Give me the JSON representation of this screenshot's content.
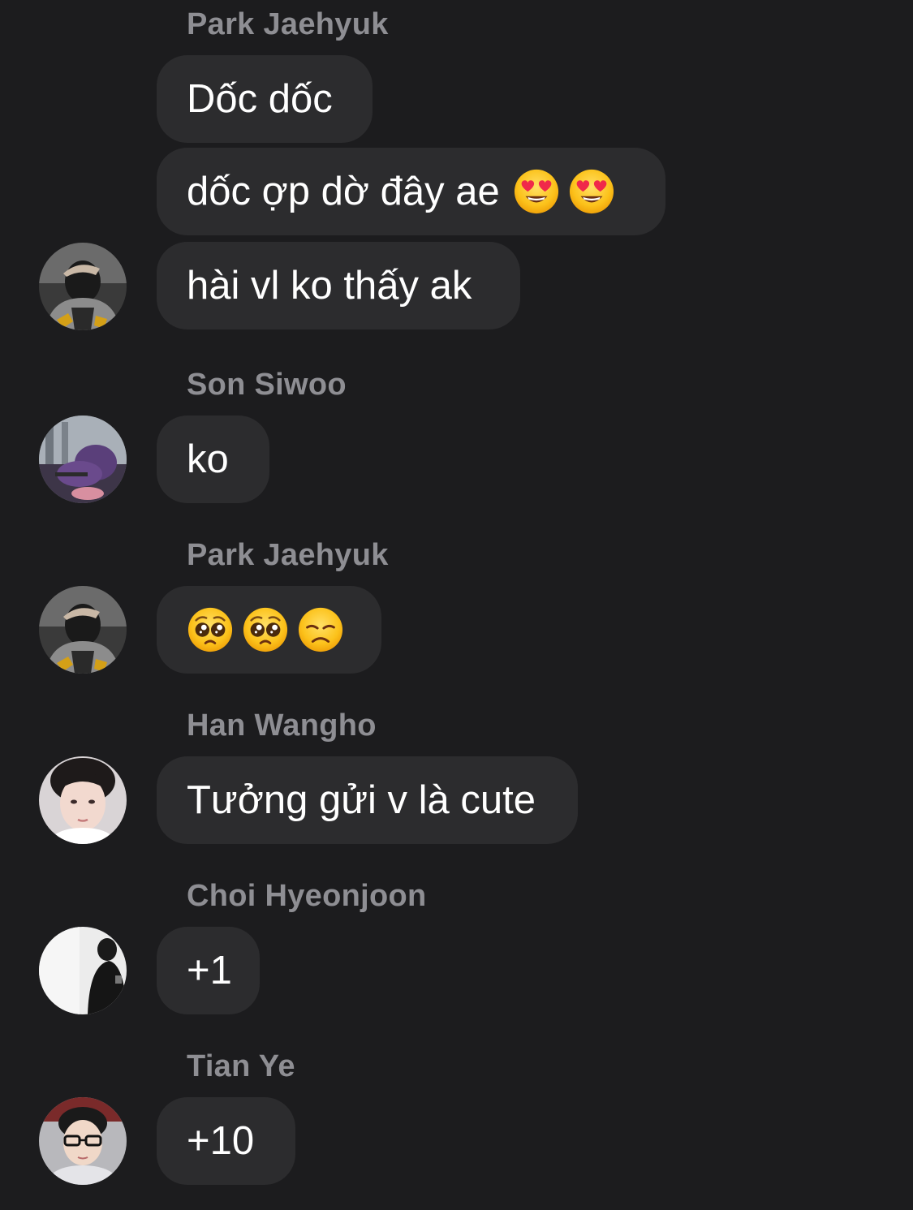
{
  "colors": {
    "background": "#1c1c1e",
    "bubble": "#2c2c2e",
    "sender_name": "#8e8e93",
    "message_text": "#ffffff"
  },
  "messages": [
    {
      "sender": "Park Jaehyuk",
      "text": "Dốc dốc"
    },
    {
      "text": "dốc ợp dờ đây ae",
      "emojis": [
        "smiling-face-with-heart-eyes",
        "smiling-face-with-heart-eyes"
      ]
    },
    {
      "text": "hài vl ko thấy ak",
      "avatar": "avatar-park-jaehyuk"
    },
    {
      "sender": "Son Siwoo",
      "text": "ko",
      "avatar": "avatar-son-siwoo"
    },
    {
      "sender": "Park Jaehyuk",
      "text": "",
      "emojis": [
        "pleading-face",
        "pleading-face",
        "disappointed-face"
      ],
      "avatar": "avatar-park-jaehyuk"
    },
    {
      "sender": "Han Wangho",
      "text": "Tưởng gửi v là cute",
      "avatar": "avatar-han-wangho"
    },
    {
      "sender": "Choi Hyeonjoon",
      "text": "+1",
      "avatar": "avatar-choi-hyeonjoon"
    },
    {
      "sender": "Tian Ye",
      "text": "+10",
      "avatar": "avatar-tian-ye"
    }
  ]
}
